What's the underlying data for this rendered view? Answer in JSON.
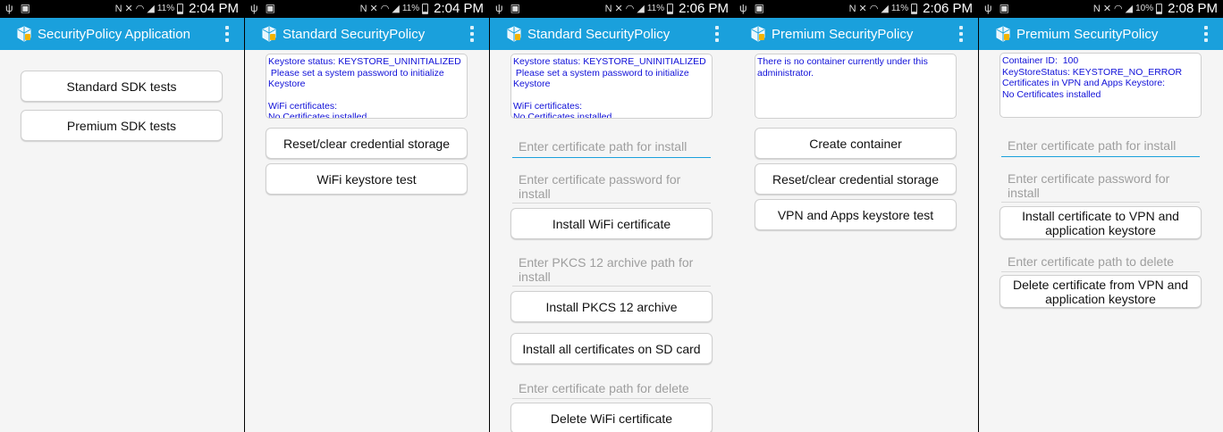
{
  "status_bars": [
    {
      "battery": "11%",
      "time": "2:04 PM"
    },
    {
      "battery": "11%",
      "time": "2:04 PM"
    },
    {
      "battery": "11%",
      "time": "2:06 PM"
    },
    {
      "battery": "11%",
      "time": "2:06 PM"
    },
    {
      "battery": "10%",
      "time": "2:08 PM"
    }
  ],
  "screens": [
    {
      "title": "SecurityPolicy Application",
      "buttons": [
        "Standard SDK tests",
        "Premium SDK tests"
      ]
    },
    {
      "title": "Standard SecurityPolicy",
      "status_lines": [
        "Keystore status: KEYSTORE_UNINITIALIZED",
        " Please set a system password to initialize Keystore",
        "",
        "WiFi certificates:",
        "No Certificates installed"
      ],
      "buttons": [
        "Reset/clear credential storage",
        "WiFi keystore test"
      ]
    },
    {
      "title": "Standard SecurityPolicy",
      "status_lines": [
        "Keystore status: KEYSTORE_UNINITIALIZED",
        " Please set a system password to initialize Keystore",
        "",
        "WiFi certificates:",
        "No Certificates installed"
      ],
      "cert_path_placeholder": "Enter certificate path for install",
      "cert_password_placeholder": "Enter certificate password for install",
      "install_wifi_button": "Install WiFi certificate",
      "pkcs_path_placeholder": "Enter PKCS 12 archive path for install",
      "install_pkcs_button": "Install PKCS 12 archive",
      "install_all_button": "Install all certificates on SD card",
      "delete_path_placeholder": "Enter certificate path for delete",
      "delete_wifi_button": "Delete WiFi certificate"
    },
    {
      "title": "Premium SecurityPolicy",
      "status_lines": [
        "There is no container currently under this administrator."
      ],
      "buttons": [
        "Create container",
        "Reset/clear credential storage",
        "VPN and Apps keystore test"
      ]
    },
    {
      "title": "Premium SecurityPolicy",
      "status_lines": [
        "Container ID:  100",
        "KeyStoreStatus: KEYSTORE_NO_ERROR",
        "Certificates in VPN and Apps Keystore:",
        "No Certificates installed"
      ],
      "cert_path_placeholder": "Enter certificate path for install",
      "cert_password_placeholder": "Enter certificate password for install",
      "install_vpn_button": "Install certificate to VPN and application keystore",
      "delete_path_placeholder": "Enter certificate path to delete",
      "delete_vpn_button": "Delete certificate from VPN and application keystore"
    }
  ],
  "colors": {
    "action_bar": "#1aa0dc",
    "status_text": "#1010d8",
    "background": "#f5f5f5"
  },
  "icons": [
    "usb-icon",
    "screenshot-icon",
    "nfc-icon",
    "mute-icon",
    "wifi-icon",
    "signal-icon",
    "battery-icon",
    "app-icon",
    "overflow-menu-icon"
  ]
}
